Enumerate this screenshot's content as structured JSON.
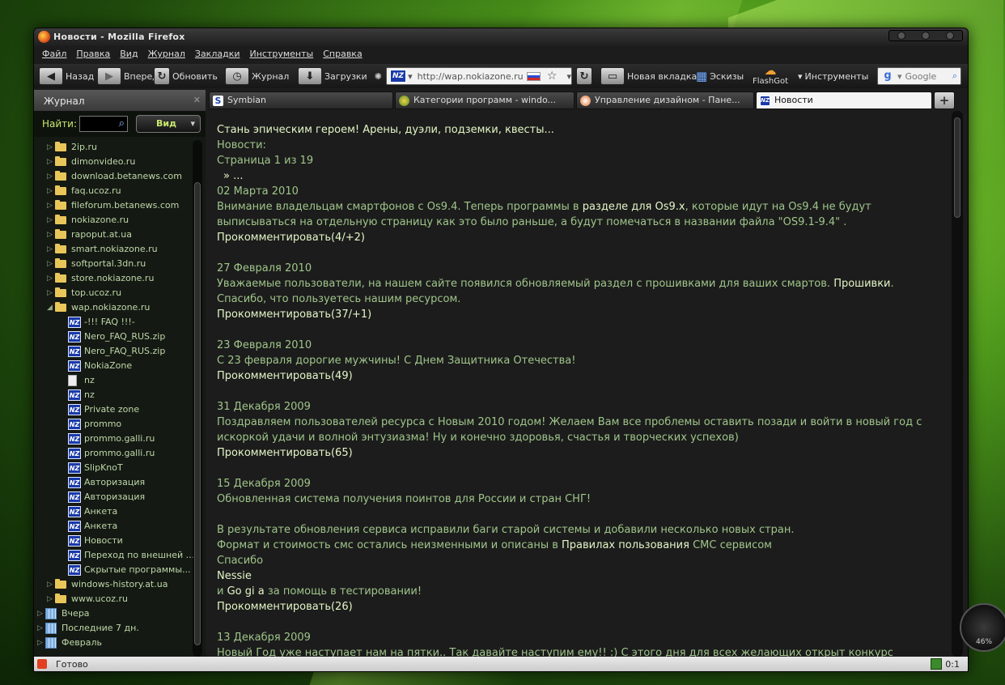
{
  "window": {
    "title": "Новости - Mozilla Firefox"
  },
  "menu": [
    "Файл",
    "Правка",
    "Вид",
    "Журнал",
    "Закладки",
    "Инструменты",
    "Справка"
  ],
  "toolbar": {
    "back": "Назад",
    "forward": "Вперед",
    "reload": "Обновить",
    "history": "Журнал",
    "downloads": "Загрузки",
    "url": "http://wap.nokiazone.ru",
    "new_tab": "Новая вкладка",
    "sketches": "Эскизы",
    "flashgot": "FlashGot",
    "tools": "Инструменты",
    "search_placeholder": "Google"
  },
  "sidebar": {
    "title": "Журнал",
    "find_label": "Найти:",
    "view_label": "Вид",
    "folders_before": [
      "2ip.ru",
      "dimonvideo.ru",
      "download.betanews.com",
      "faq.ucoz.ru",
      "fileforum.betanews.com",
      "nokiazone.ru",
      "rapoput.at.ua",
      "smart.nokiazone.ru",
      "softportal.3dn.ru",
      "store.nokiazone.ru",
      "top.ucoz.ru"
    ],
    "open_folder": "wap.nokiazone.ru",
    "pages": [
      {
        "icon": "nz",
        "label": "-!!! FAQ !!!-"
      },
      {
        "icon": "nz",
        "label": "Nero_FAQ_RUS.zip"
      },
      {
        "icon": "nz",
        "label": "Nero_FAQ_RUS.zip"
      },
      {
        "icon": "nz",
        "label": "NokiaZone"
      },
      {
        "icon": "doc",
        "label": "nz"
      },
      {
        "icon": "nz",
        "label": "nz"
      },
      {
        "icon": "nz",
        "label": "Private zone"
      },
      {
        "icon": "nz",
        "label": "prommo"
      },
      {
        "icon": "nz",
        "label": "prommo.galli.ru"
      },
      {
        "icon": "nz",
        "label": "prommo.galli.ru"
      },
      {
        "icon": "nz",
        "label": "SlipKnoT"
      },
      {
        "icon": "nz",
        "label": "Авторизация"
      },
      {
        "icon": "nz",
        "label": "Авторизация"
      },
      {
        "icon": "nz",
        "label": "Анкета"
      },
      {
        "icon": "nz",
        "label": "Анкета"
      },
      {
        "icon": "nz",
        "label": "Новости"
      },
      {
        "icon": "nz",
        "label": "Переход по внешней ..."
      },
      {
        "icon": "nz",
        "label": "Скрытые программы..."
      }
    ],
    "folders_after": [
      "windows-history.at.ua",
      "www.ucoz.ru"
    ],
    "groups": [
      "Вчера",
      "Последние 7 дн.",
      "Февраль"
    ]
  },
  "tabs": [
    {
      "label": "Symbian",
      "active": false
    },
    {
      "label": "Категории программ - windo...",
      "active": false
    },
    {
      "label": "Управление дизайном - Пане...",
      "active": false
    },
    {
      "label": "Новости",
      "active": true
    }
  ],
  "page": {
    "banner": "Стань эпическим героем! Арены, дуэли, подземки, квесты...",
    "section": "Новости:",
    "pagination": "Страница 1 из 19",
    "more": "» ...",
    "news": [
      {
        "date": "02 Марта 2010",
        "lines": [
          [
            {
              "t": "Внимание владельцам смартфонов с Os9.4. Теперь программы в "
            },
            {
              "t": "разделе для Os9.x",
              "hl": true
            },
            {
              "t": ", которые идут на Os9.4 не будут"
            }
          ],
          [
            {
              "t": "выписываться на отдельную страницу как это было раньше, а будут помечаться в названии файла \"OS9.1-9.4\" ."
            }
          ]
        ],
        "comment": "Прокомментировать(4/+2)"
      },
      {
        "date": "27 Февраля 2010",
        "lines": [
          [
            {
              "t": "Уважаемые пользователи, на нашем сайте появился обновляемый раздел с прошивками для ваших смартов. "
            },
            {
              "t": "Прошивки",
              "hl": true
            },
            {
              "t": "."
            }
          ],
          [
            {
              "t": "Спасибо, что пользуетесь нашим ресурсом."
            }
          ]
        ],
        "comment": "Прокомментировать(37/+1)"
      },
      {
        "date": "23 Февраля 2010",
        "lines": [
          [
            {
              "t": "С 23 февраля дорогие мужчины! С Днем Защитника Отечества!"
            }
          ]
        ],
        "comment": "Прокомментировать(49)"
      },
      {
        "date": "31 Декабря 2009",
        "lines": [
          [
            {
              "t": "Поздравляем пользователей ресурса с Новым 2010 годом! Желаем Вам все проблемы оставить позади и войти в новый год с"
            }
          ],
          [
            {
              "t": "искоркой удачи и волной энтузиазма! Ну и конечно здоровья, счастья и творческих успехов)"
            }
          ]
        ],
        "comment": "Прокомментировать(65)"
      },
      {
        "date": "15 Декабря 2009",
        "lines": [
          [
            {
              "t": "Обновленная система получения поинтов для России и стран СНГ!"
            }
          ],
          [
            {
              "t": ""
            }
          ],
          [
            {
              "t": "В результате обновления сервиса исправили баги старой системы и добавили несколько новых стран."
            }
          ],
          [
            {
              "t": "Формат и стоимость смс остались неизменными и описаны в "
            },
            {
              "t": "Правилах пользования",
              "hl": true
            },
            {
              "t": " СМС сервисом"
            }
          ],
          [
            {
              "t": "Спасибо"
            }
          ],
          [
            {
              "t": "Nessie",
              "hl": true
            }
          ],
          [
            {
              "t": "и "
            },
            {
              "t": "Go gi a",
              "hl": true
            },
            {
              "t": " за помощь в тестировании!"
            }
          ]
        ],
        "comment": "Прокомментировать(26)"
      },
      {
        "date": "13 Декабря 2009",
        "lines": [
          [
            {
              "t": "Новый Год уже наступает нам на пятки.. Так давайте наступим ему!! :) С этого дня для всех желающих открыт конкурс"
            }
          ]
        ],
        "comment": ""
      }
    ]
  },
  "status": {
    "text": "Готово",
    "right": "0:1"
  },
  "gadget": {
    "value": "46%"
  }
}
